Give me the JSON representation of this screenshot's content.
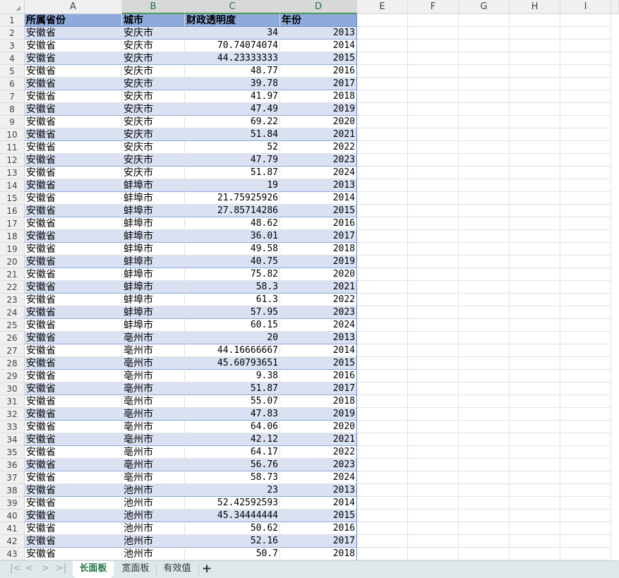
{
  "columns": [
    "A",
    "B",
    "C",
    "D",
    "E",
    "F",
    "G",
    "H",
    "I"
  ],
  "header": [
    "所属省份",
    "城市",
    "财政透明度",
    "年份"
  ],
  "rows": [
    [
      "安徽省",
      "安庆市",
      "34",
      "2013"
    ],
    [
      "安徽省",
      "安庆市",
      "70.74074074",
      "2014"
    ],
    [
      "安徽省",
      "安庆市",
      "44.23333333",
      "2015"
    ],
    [
      "安徽省",
      "安庆市",
      "48.77",
      "2016"
    ],
    [
      "安徽省",
      "安庆市",
      "39.78",
      "2017"
    ],
    [
      "安徽省",
      "安庆市",
      "41.97",
      "2018"
    ],
    [
      "安徽省",
      "安庆市",
      "47.49",
      "2019"
    ],
    [
      "安徽省",
      "安庆市",
      "69.22",
      "2020"
    ],
    [
      "安徽省",
      "安庆市",
      "51.84",
      "2021"
    ],
    [
      "安徽省",
      "安庆市",
      "52",
      "2022"
    ],
    [
      "安徽省",
      "安庆市",
      "47.79",
      "2023"
    ],
    [
      "安徽省",
      "安庆市",
      "51.87",
      "2024"
    ],
    [
      "安徽省",
      "蚌埠市",
      "19",
      "2013"
    ],
    [
      "安徽省",
      "蚌埠市",
      "21.75925926",
      "2014"
    ],
    [
      "安徽省",
      "蚌埠市",
      "27.85714286",
      "2015"
    ],
    [
      "安徽省",
      "蚌埠市",
      "48.62",
      "2016"
    ],
    [
      "安徽省",
      "蚌埠市",
      "36.01",
      "2017"
    ],
    [
      "安徽省",
      "蚌埠市",
      "49.58",
      "2018"
    ],
    [
      "安徽省",
      "蚌埠市",
      "40.75",
      "2019"
    ],
    [
      "安徽省",
      "蚌埠市",
      "75.82",
      "2020"
    ],
    [
      "安徽省",
      "蚌埠市",
      "58.3",
      "2021"
    ],
    [
      "安徽省",
      "蚌埠市",
      "61.3",
      "2022"
    ],
    [
      "安徽省",
      "蚌埠市",
      "57.95",
      "2023"
    ],
    [
      "安徽省",
      "蚌埠市",
      "60.15",
      "2024"
    ],
    [
      "安徽省",
      "亳州市",
      "20",
      "2013"
    ],
    [
      "安徽省",
      "亳州市",
      "44.16666667",
      "2014"
    ],
    [
      "安徽省",
      "亳州市",
      "45.60793651",
      "2015"
    ],
    [
      "安徽省",
      "亳州市",
      "9.38",
      "2016"
    ],
    [
      "安徽省",
      "亳州市",
      "51.87",
      "2017"
    ],
    [
      "安徽省",
      "亳州市",
      "55.07",
      "2018"
    ],
    [
      "安徽省",
      "亳州市",
      "47.83",
      "2019"
    ],
    [
      "安徽省",
      "亳州市",
      "64.06",
      "2020"
    ],
    [
      "安徽省",
      "亳州市",
      "42.12",
      "2021"
    ],
    [
      "安徽省",
      "亳州市",
      "64.17",
      "2022"
    ],
    [
      "安徽省",
      "亳州市",
      "56.76",
      "2023"
    ],
    [
      "安徽省",
      "亳州市",
      "58.73",
      "2024"
    ],
    [
      "安徽省",
      "池州市",
      "23",
      "2013"
    ],
    [
      "安徽省",
      "池州市",
      "52.42592593",
      "2014"
    ],
    [
      "安徽省",
      "池州市",
      "45.34444444",
      "2015"
    ],
    [
      "安徽省",
      "池州市",
      "50.62",
      "2016"
    ],
    [
      "安徽省",
      "池州市",
      "52.16",
      "2017"
    ],
    [
      "安徽省",
      "池州市",
      "50.7",
      "2018"
    ]
  ],
  "tabs": [
    "长面板",
    "宽面板",
    "有效值"
  ],
  "add_tab": "+",
  "nav_icons": [
    "|<",
    "<",
    ">",
    ">|"
  ]
}
